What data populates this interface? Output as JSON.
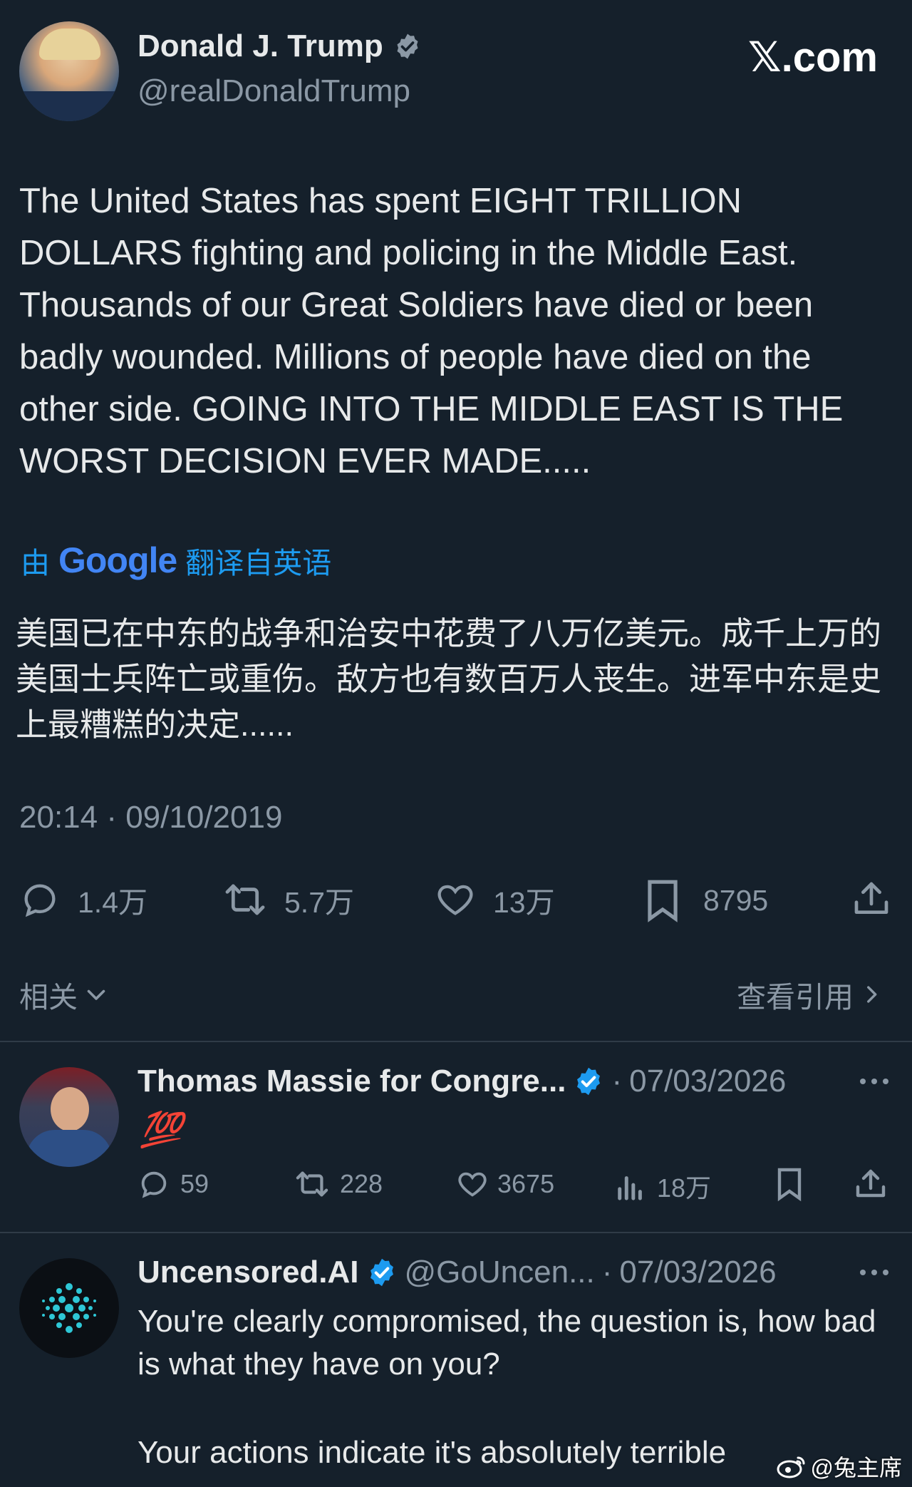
{
  "main_tweet": {
    "author_name": "Donald J. Trump",
    "handle": "@realDonaldTrump",
    "site_badge": "𝕏.com",
    "text_en": "The United States has spent EIGHT TRILLION DOLLARS fighting and policing in the Middle East. Thousands of our Great Soldiers have died or been badly wounded. Millions of people have died on the other side. GOING INTO THE MIDDLE EAST IS THE WORST DECISION EVER MADE.....",
    "translate_prefix": "由",
    "translate_brand": "Google",
    "translate_suffix": "翻译自英语",
    "text_zh": "美国已在中东的战争和治安中花费了八万亿美元。成千上万的美国士兵阵亡或重伤。敌方也有数百万人丧生。进军中东是史上最糟糕的决定......",
    "timestamp": "20:14 · 09/10/2019",
    "stats": {
      "replies": "1.4万",
      "retweets": "5.7万",
      "likes": "13万",
      "bookmarks": "8795"
    }
  },
  "filter_bar": {
    "sort_label": "相关",
    "quotes_label": "查看引用"
  },
  "replies": [
    {
      "author_name": "Thomas Massie for Congre...",
      "separator": "·",
      "date": "07/03/2026",
      "emoji": "💯",
      "stats": {
        "replies": "59",
        "retweets": "228",
        "likes": "3675",
        "views": "18万"
      }
    },
    {
      "author_name": "Uncensored.AI",
      "handle": "@GoUncen...",
      "separator": "·",
      "date": "07/03/2026",
      "text_line1": "You're clearly compromised, the question is, how bad is what they have on you?",
      "text_line2": "Your actions indicate it's absolutely terrible"
    }
  ],
  "watermark": "@兔主席",
  "colors": {
    "background": "#15202b",
    "text": "#e7e9ea",
    "muted": "#8b98a5",
    "verified": "#1d9bf0",
    "translate_link": "#1d9bf0"
  }
}
